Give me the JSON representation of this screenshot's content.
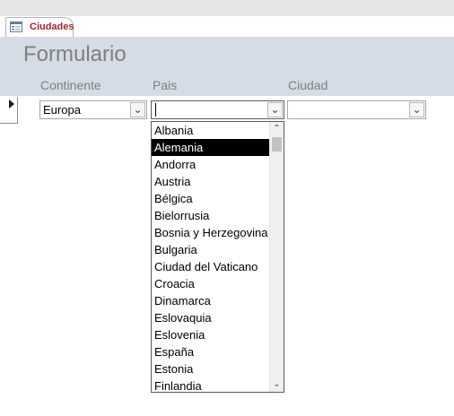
{
  "tab": {
    "label": "Ciudades",
    "icon": "form-icon"
  },
  "form": {
    "title": "Formulario"
  },
  "columns": {
    "continente": "Continente",
    "pais": "Pais",
    "ciudad": "Ciudad"
  },
  "fields": {
    "continente_value": "Europa",
    "pais_value": "",
    "ciudad_value": ""
  },
  "dropdown": {
    "items": [
      "Albania",
      "Alemania",
      "Andorra",
      "Austria",
      "Bélgica",
      "Bielorrusia",
      "Bosnia y Herzegovina",
      "Bulgaria",
      "Ciudad del Vaticano",
      "Croacia",
      "Dinamarca",
      "Eslovaquia",
      "Eslovenia",
      "España",
      "Estonia",
      "Finlandia"
    ],
    "selected_index": 1
  },
  "colors": {
    "tab_label": "#a4262c",
    "header_bg": "#d6dce5",
    "label_text": "#7f7f7f",
    "selection_bg": "#000000"
  }
}
